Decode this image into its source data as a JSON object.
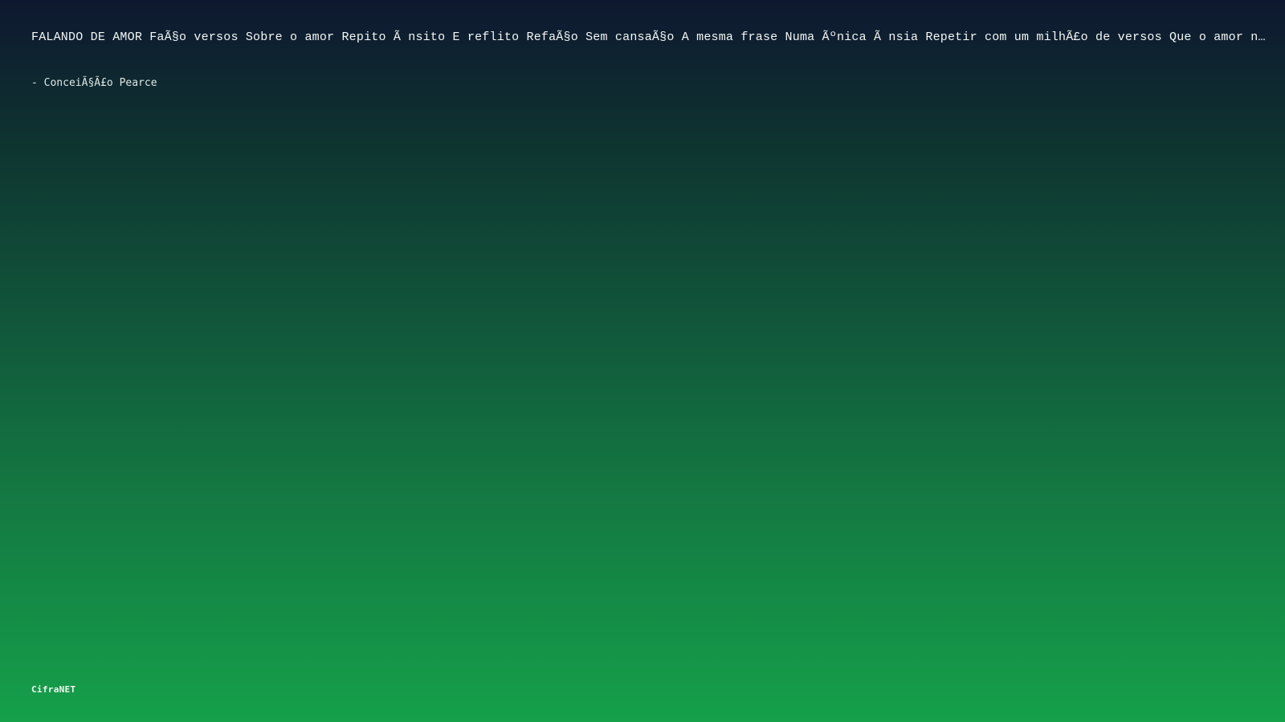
{
  "quote": {
    "text": "FALANDO DE AMOR FaÃ§o versos Sobre o amor Repito Ã nsito E reflito RefaÃ§o Sem cansaÃ§o A mesma frase Numa Ãºnica Ã nsia Repetir com um milhÃ£o de versos Que o amor nÃ£...",
    "author": "- ConceiÃ§Ã£o Pearce"
  },
  "footer": {
    "brand": "CifraNET"
  }
}
